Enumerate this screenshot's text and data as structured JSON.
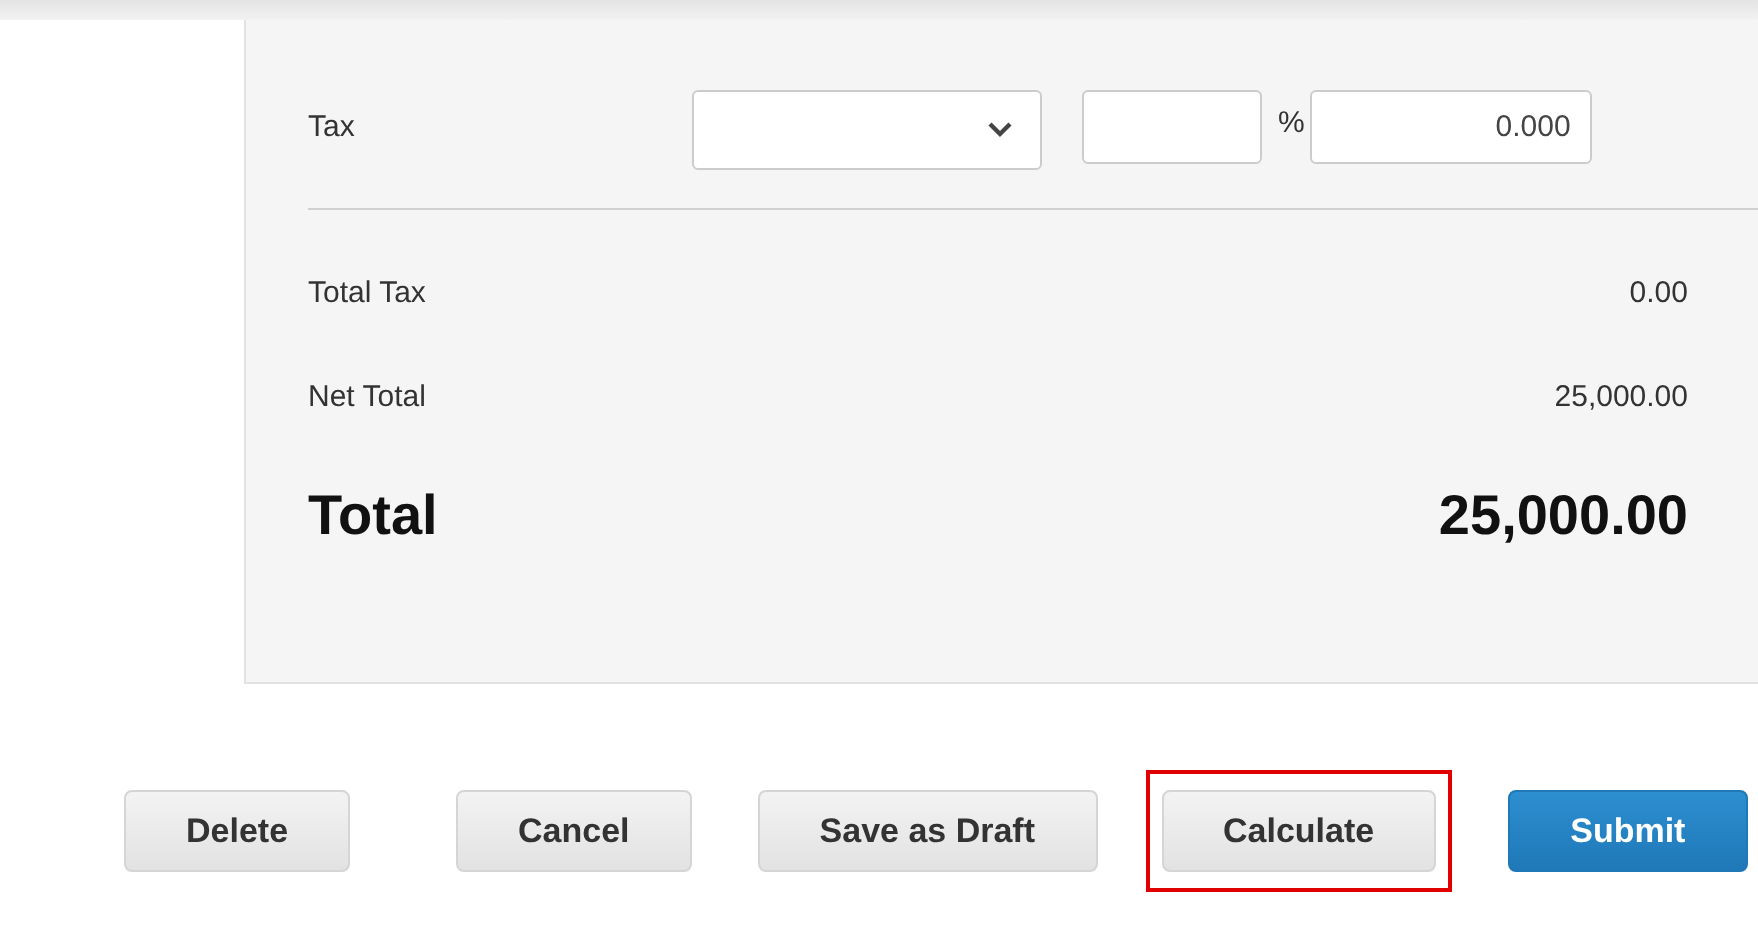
{
  "tax": {
    "label": "Tax",
    "percent_sign": "%",
    "amount": "0.000"
  },
  "totals": [
    {
      "label": "Total Tax",
      "value": "0.00",
      "kind": "normal"
    },
    {
      "label": "Net Total",
      "value": "25,000.00",
      "kind": "normal"
    },
    {
      "label": "Total",
      "value": "25,000.00",
      "kind": "grand"
    }
  ],
  "buttons": [
    {
      "label": "Delete",
      "kind": "default",
      "highlighted": false
    },
    {
      "label": "Cancel",
      "kind": "default",
      "highlighted": false
    },
    {
      "label": "Save as Draft",
      "kind": "default",
      "highlighted": false
    },
    {
      "label": "Calculate",
      "kind": "default",
      "highlighted": true
    },
    {
      "label": "Submit",
      "kind": "primary",
      "highlighted": false
    }
  ]
}
